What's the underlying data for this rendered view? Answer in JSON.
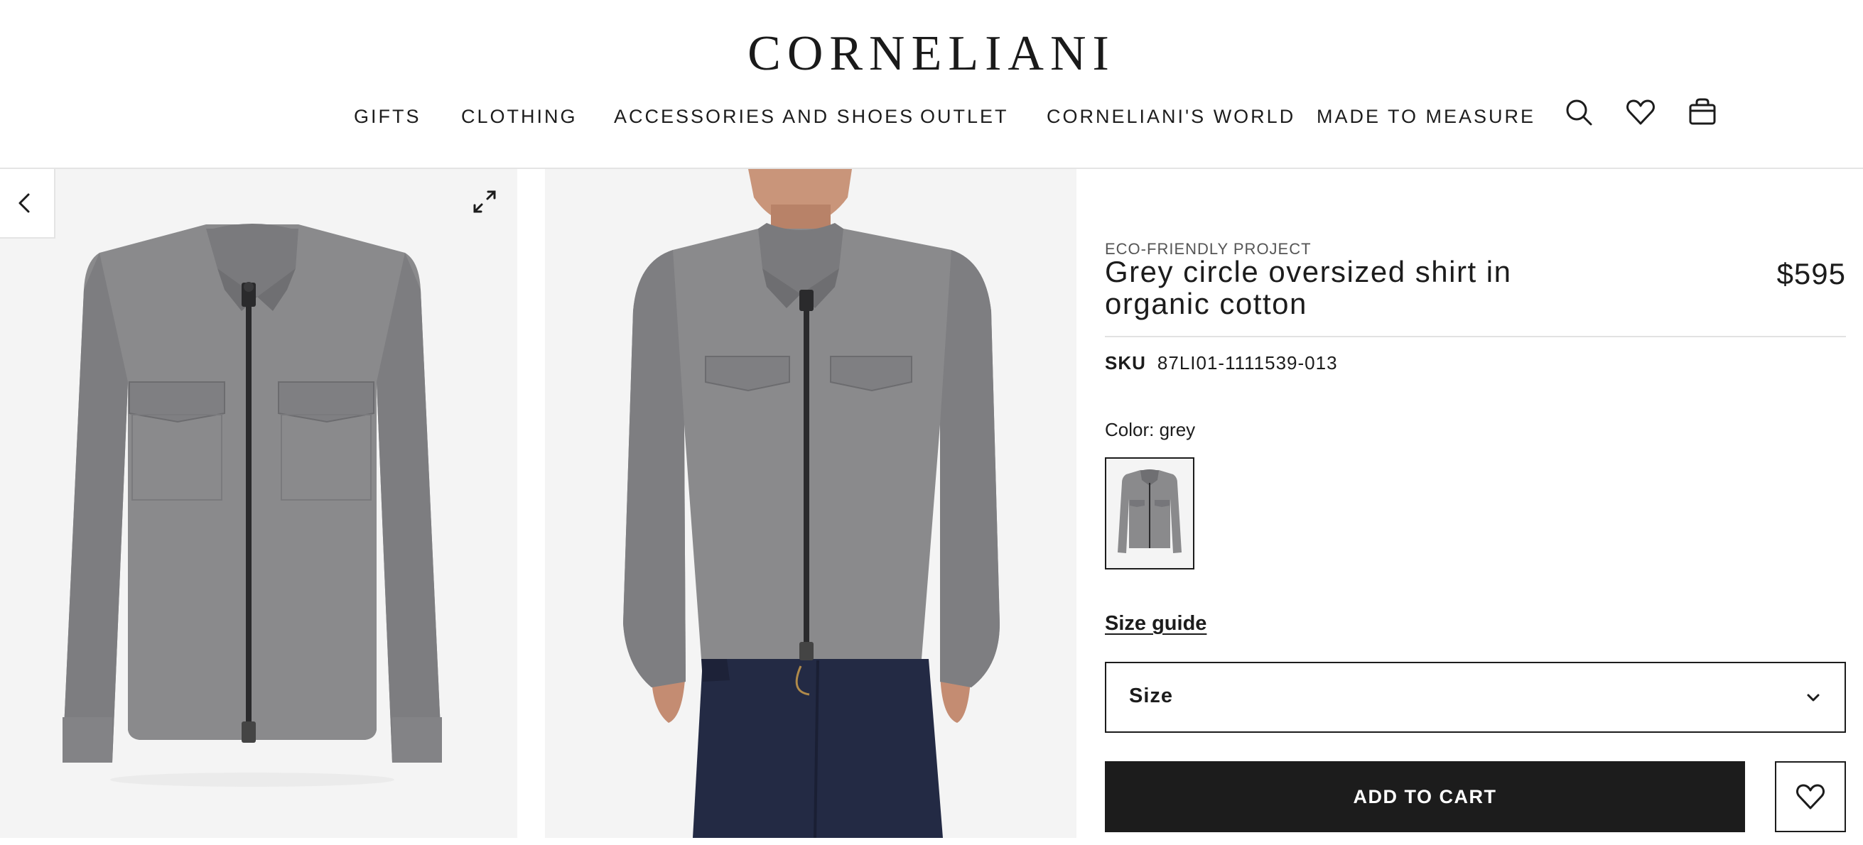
{
  "header": {
    "logo": "CORNELIANI",
    "nav": [
      {
        "label": "GIFTS"
      },
      {
        "label": "CLOTHING"
      },
      {
        "label": "ACCESSORIES AND SHOES"
      },
      {
        "label": "OUTLET"
      },
      {
        "label": "CORNELIANI'S WORLD"
      },
      {
        "label": "MADE TO MEASURE"
      }
    ],
    "icons": [
      "search-icon",
      "heart-icon",
      "bag-icon"
    ]
  },
  "gallery": {
    "icons": [
      "chevron-left-icon",
      "expand-icon"
    ]
  },
  "product": {
    "eyebrow": "ECO-FRIENDLY PROJECT",
    "title": "Grey circle oversized shirt in organic cotton",
    "price": "$595",
    "sku_label": "SKU",
    "sku": "87LI01-1111539-013",
    "color_label": "Color: grey",
    "size_guide": "Size guide",
    "size_placeholder": "Size",
    "add_to_cart": "ADD TO CART"
  },
  "colors": {
    "accent": "#1c1c1c",
    "image_bg": "#f4f4f4",
    "shirt": "#8a8a8c",
    "denim": "#232a44"
  }
}
